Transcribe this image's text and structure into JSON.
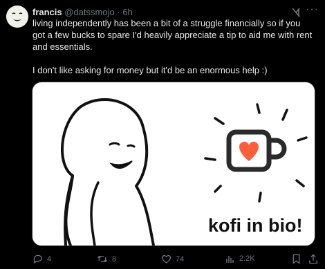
{
  "tweet": {
    "author_name": "francis",
    "handle": "@datssmojo",
    "separator": "·",
    "time": "6h",
    "text": "living independently has been a bit of a struggle financially so if you got a few bucks to spare I'd heavily appreciate a tip to aid me with rent and essentials.\n\nI don't like asking for money but it'd be an enormous help :)",
    "image_caption": "kofi in bio!"
  },
  "actions": {
    "replies": "4",
    "reposts": "8",
    "likes": "74",
    "views": "2.2K"
  },
  "icons": {
    "grok": "grok-icon",
    "more": "more-icon",
    "reply": "reply-icon",
    "repost": "repost-icon",
    "like": "heart-icon",
    "views": "views-icon",
    "bookmark": "bookmark-icon",
    "share": "share-icon"
  },
  "colors": {
    "background": "#000000",
    "text": "#e7e9ea",
    "muted": "#71767b",
    "kofi_heart": "#ff5e3a"
  }
}
